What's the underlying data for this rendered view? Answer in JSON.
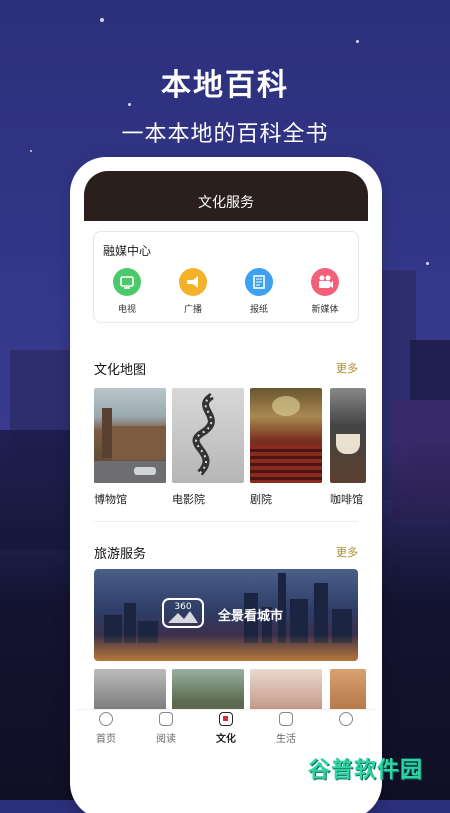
{
  "headline": {
    "title": "本地百科",
    "subtitle": "一本本地的百科全书"
  },
  "app": {
    "header_title": "文化服务",
    "media_center": {
      "title": "融媒中心",
      "items": [
        {
          "label": "电视",
          "icon": "tv-icon",
          "color": "#4cc96b"
        },
        {
          "label": "广播",
          "icon": "megaphone-icon",
          "color": "#f4b12a"
        },
        {
          "label": "报纸",
          "icon": "newspaper-icon",
          "color": "#3da0f0"
        },
        {
          "label": "新媒体",
          "icon": "video-camera-icon",
          "color": "#f2607a"
        }
      ]
    },
    "culture_map": {
      "title": "文化地图",
      "more": "更多",
      "items": [
        {
          "label": "博物馆"
        },
        {
          "label": "电影院"
        },
        {
          "label": "剧院"
        },
        {
          "label": "咖啡馆"
        }
      ]
    },
    "travel": {
      "title": "旅游服务",
      "more": "更多",
      "banner_icon_text": "360",
      "banner_text": "全景看城市"
    },
    "tabs": [
      {
        "label": "首页",
        "icon": "home-chat-icon",
        "active": false
      },
      {
        "label": "阅读",
        "icon": "read-icon",
        "active": false
      },
      {
        "label": "文化",
        "icon": "culture-icon",
        "active": true
      },
      {
        "label": "生活",
        "icon": "life-icon",
        "active": false
      },
      {
        "label": "",
        "icon": "profile-icon",
        "active": false
      }
    ]
  },
  "watermark": "谷普软件园",
  "colors": {
    "accent_more": "#b08a2e",
    "header_bg": "#2b1f1e",
    "active_tab": "#d2303c"
  }
}
